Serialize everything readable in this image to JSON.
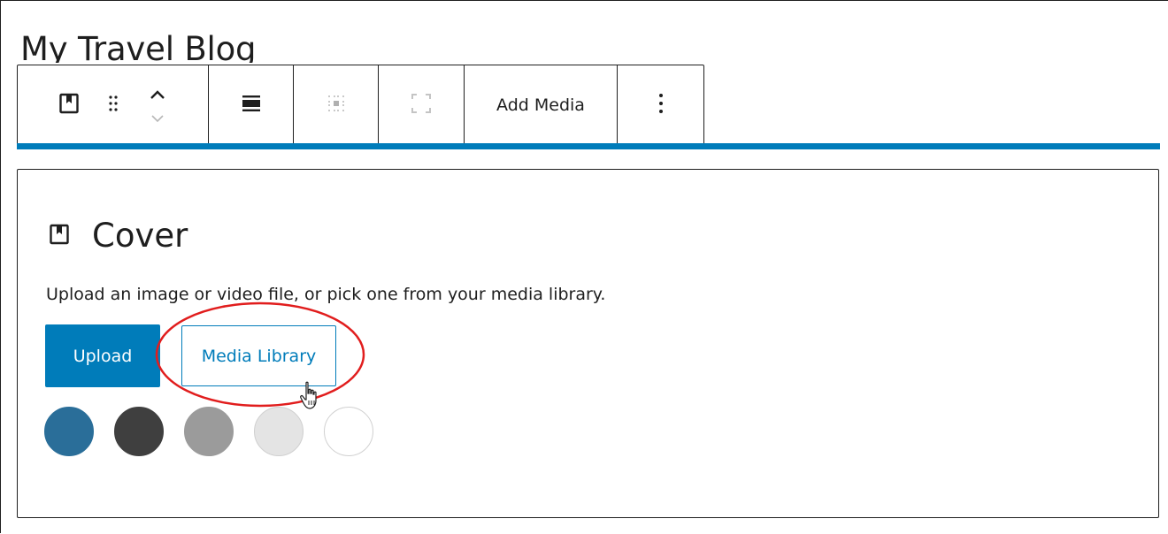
{
  "page": {
    "blog_title": "My Travel Blog"
  },
  "toolbar": {
    "block_type_icon": "cover-block-icon",
    "drag_icon": "drag-handle-icon",
    "move_up_icon": "chevron-up-icon",
    "move_down_icon": "chevron-down-icon",
    "align_icon": "align-wide-icon",
    "position_icon": "content-position-icon",
    "fullheight_icon": "full-height-icon",
    "add_media_label": "Add Media",
    "more_icon": "more-vertical-icon"
  },
  "cover": {
    "title": "Cover",
    "instructions": "Upload an image or video file, or pick one from your media library.",
    "upload_label": "Upload",
    "media_library_label": "Media Library",
    "swatches": [
      "#2a6e99",
      "#3f3f3f",
      "#9b9b9b",
      "#e4e4e4",
      "#ffffff"
    ]
  },
  "colors": {
    "accent": "#007cba",
    "annotation": "#e11d1d",
    "text": "#1e1e1e"
  }
}
